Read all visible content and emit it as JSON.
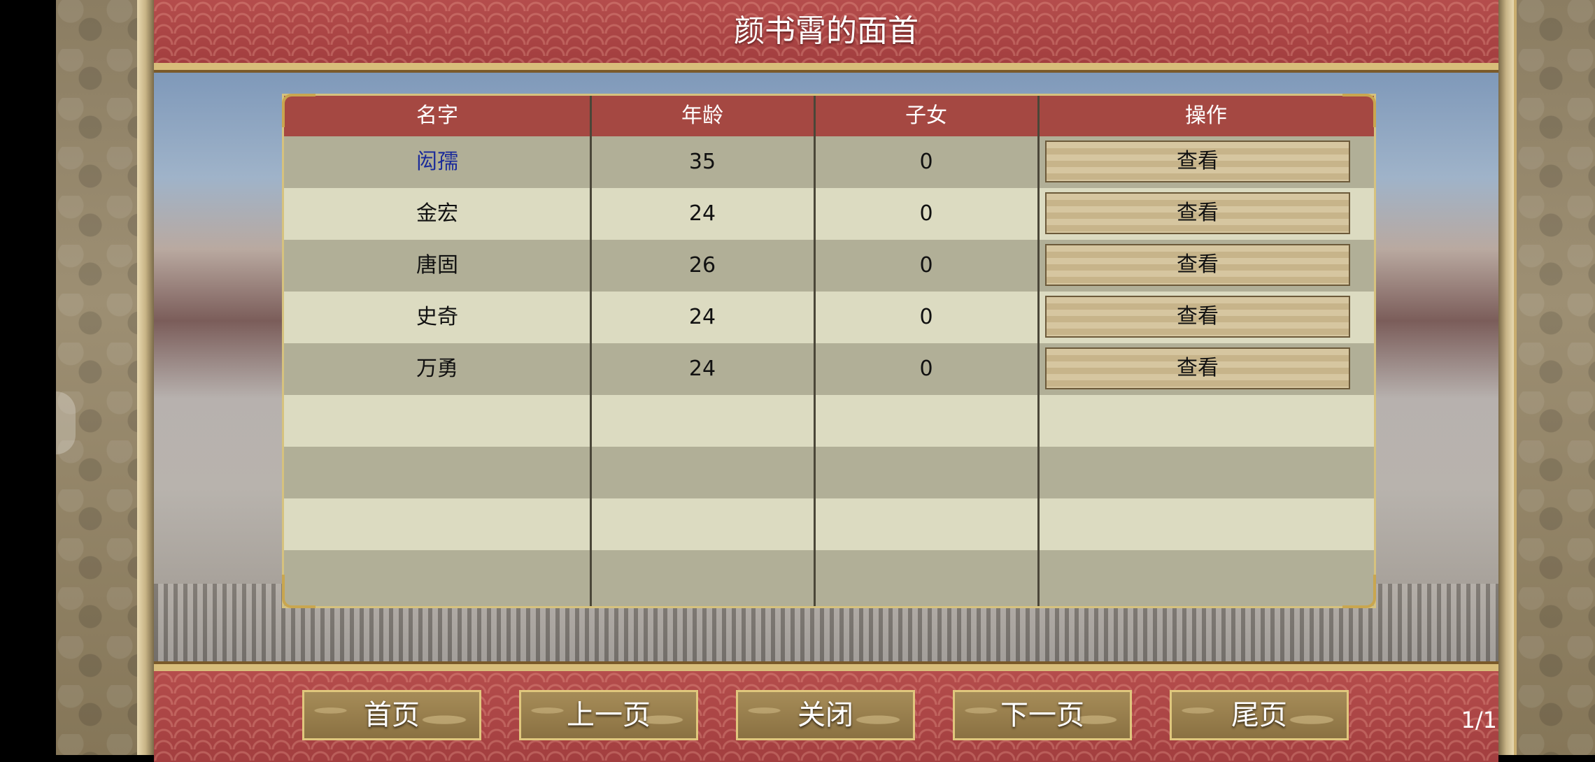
{
  "title": "颜书霄的面首",
  "table": {
    "headers": [
      "名字",
      "年龄",
      "子女",
      "操作"
    ],
    "rows": [
      {
        "name": "闳孺",
        "age": "35",
        "children": "0",
        "action": "查看"
      },
      {
        "name": "金宏",
        "age": "24",
        "children": "0",
        "action": "查看"
      },
      {
        "name": "唐固",
        "age": "26",
        "children": "0",
        "action": "查看"
      },
      {
        "name": "史奇",
        "age": "24",
        "children": "0",
        "action": "查看"
      },
      {
        "name": "万勇",
        "age": "24",
        "children": "0",
        "action": "查看"
      }
    ]
  },
  "footer": {
    "first": "首页",
    "prev": "上一页",
    "close": "关闭",
    "next": "下一页",
    "last": "尾页",
    "page_indicator": "1/1"
  }
}
